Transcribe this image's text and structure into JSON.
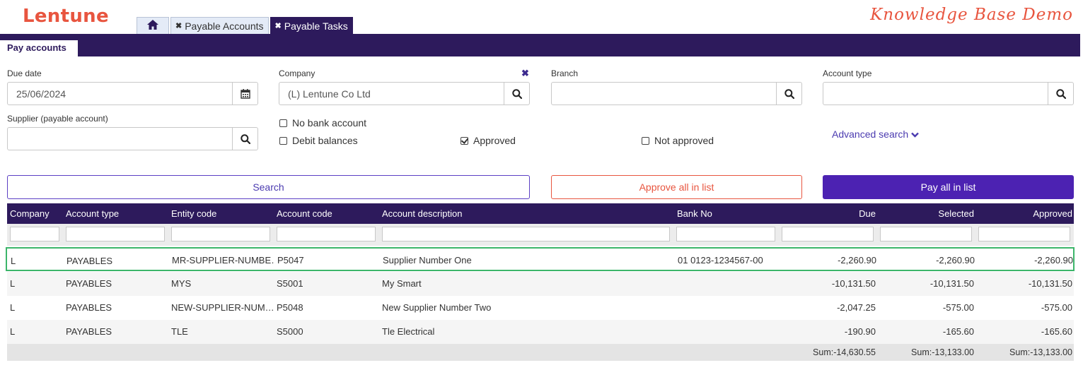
{
  "header": {
    "logo": "Lentune",
    "demo_label": "Knowledge Base Demo",
    "tabs": [
      {
        "label": "Payable Accounts"
      },
      {
        "label": "Payable Tasks"
      }
    ],
    "nav_tab": "Pay accounts"
  },
  "form": {
    "due_date": {
      "label": "Due date",
      "value": "25/06/2024"
    },
    "company": {
      "label": "Company",
      "value": "(L) Lentune Co Ltd"
    },
    "branch": {
      "label": "Branch",
      "value": ""
    },
    "account_type": {
      "label": "Account type",
      "value": ""
    },
    "supplier": {
      "label": "Supplier (payable account)",
      "value": ""
    },
    "checkboxes": {
      "no_bank_account": {
        "label": "No bank account",
        "checked": false
      },
      "debit_balances": {
        "label": "Debit balances",
        "checked": false
      },
      "approved": {
        "label": "Approved",
        "checked": true
      },
      "not_approved": {
        "label": "Not approved",
        "checked": false
      }
    },
    "advanced_search": "Advanced search"
  },
  "actions": {
    "search": "Search",
    "approve_all": "Approve all in list",
    "pay_all": "Pay all in list"
  },
  "table": {
    "columns": [
      "Company",
      "Account type",
      "Entity code",
      "Account code",
      "Account description",
      "Bank No",
      "Due",
      "Selected",
      "Approved"
    ],
    "rows": [
      {
        "company": "L",
        "account_type": "PAYABLES",
        "entity_code": "MR-SUPPLIER-NUMBE…",
        "account_code": "P5047",
        "description": "Supplier Number One",
        "bank_no": "01 0123-1234567-00",
        "due": "-2,260.90",
        "selected": "-2,260.90",
        "approved": "-2,260.90"
      },
      {
        "company": "L",
        "account_type": "PAYABLES",
        "entity_code": "MYS",
        "account_code": "S5001",
        "description": "My Smart",
        "bank_no": "",
        "due": "-10,131.50",
        "selected": "-10,131.50",
        "approved": "-10,131.50"
      },
      {
        "company": "L",
        "account_type": "PAYABLES",
        "entity_code": "NEW-SUPPLIER-NUM…",
        "account_code": "P5048",
        "description": "New Supplier Number Two",
        "bank_no": "",
        "due": "-2,047.25",
        "selected": "-575.00",
        "approved": "-575.00"
      },
      {
        "company": "L",
        "account_type": "PAYABLES",
        "entity_code": "TLE",
        "account_code": "S5000",
        "description": "Tle Electrical",
        "bank_no": "",
        "due": "-190.90",
        "selected": "-165.60",
        "approved": "-165.60"
      }
    ],
    "sums": {
      "due": "Sum:-14,630.55",
      "selected": "Sum:-13,133.00",
      "approved": "Sum:-13,133.00"
    }
  },
  "colors": {
    "brand": "#e8553f",
    "primary": "#2d1a5c",
    "accent": "#4c22b2",
    "highlight": "#3cb56a"
  }
}
